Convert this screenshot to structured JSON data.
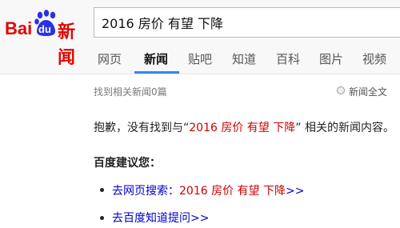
{
  "logo": {
    "bai": "Bai",
    "du": "du",
    "xinwen": "新闻"
  },
  "search": {
    "value": "2016 房价 有望 下降"
  },
  "tabs": [
    {
      "label": "网页",
      "active": false
    },
    {
      "label": "新闻",
      "active": true
    },
    {
      "label": "贴吧",
      "active": false
    },
    {
      "label": "知道",
      "active": false
    },
    {
      "label": "百科",
      "active": false
    },
    {
      "label": "图片",
      "active": false
    },
    {
      "label": "视频",
      "active": false
    }
  ],
  "result_count": "找到相关新闻0篇",
  "fulltext_option": {
    "label": "新闻全文",
    "checked": false
  },
  "notice": {
    "prefix": "抱歉，没有找到与“",
    "query": "2016 房价 有望 下降",
    "suffix": "” 相关的新闻内容。"
  },
  "suggestions": {
    "title": "百度建议您：",
    "web_search": {
      "label": "去网页搜索：",
      "query": "2016 房价 有望 下降",
      "arrow": ">>"
    },
    "zhidao": {
      "label": "去百度知道提问",
      "arrow": ">>"
    }
  },
  "colors": {
    "brand_red": "#e10602",
    "brand_blue": "#2932e1",
    "link_blue": "#0000cc",
    "query_red": "#cc0000",
    "tab_accent": "#3385ff"
  }
}
